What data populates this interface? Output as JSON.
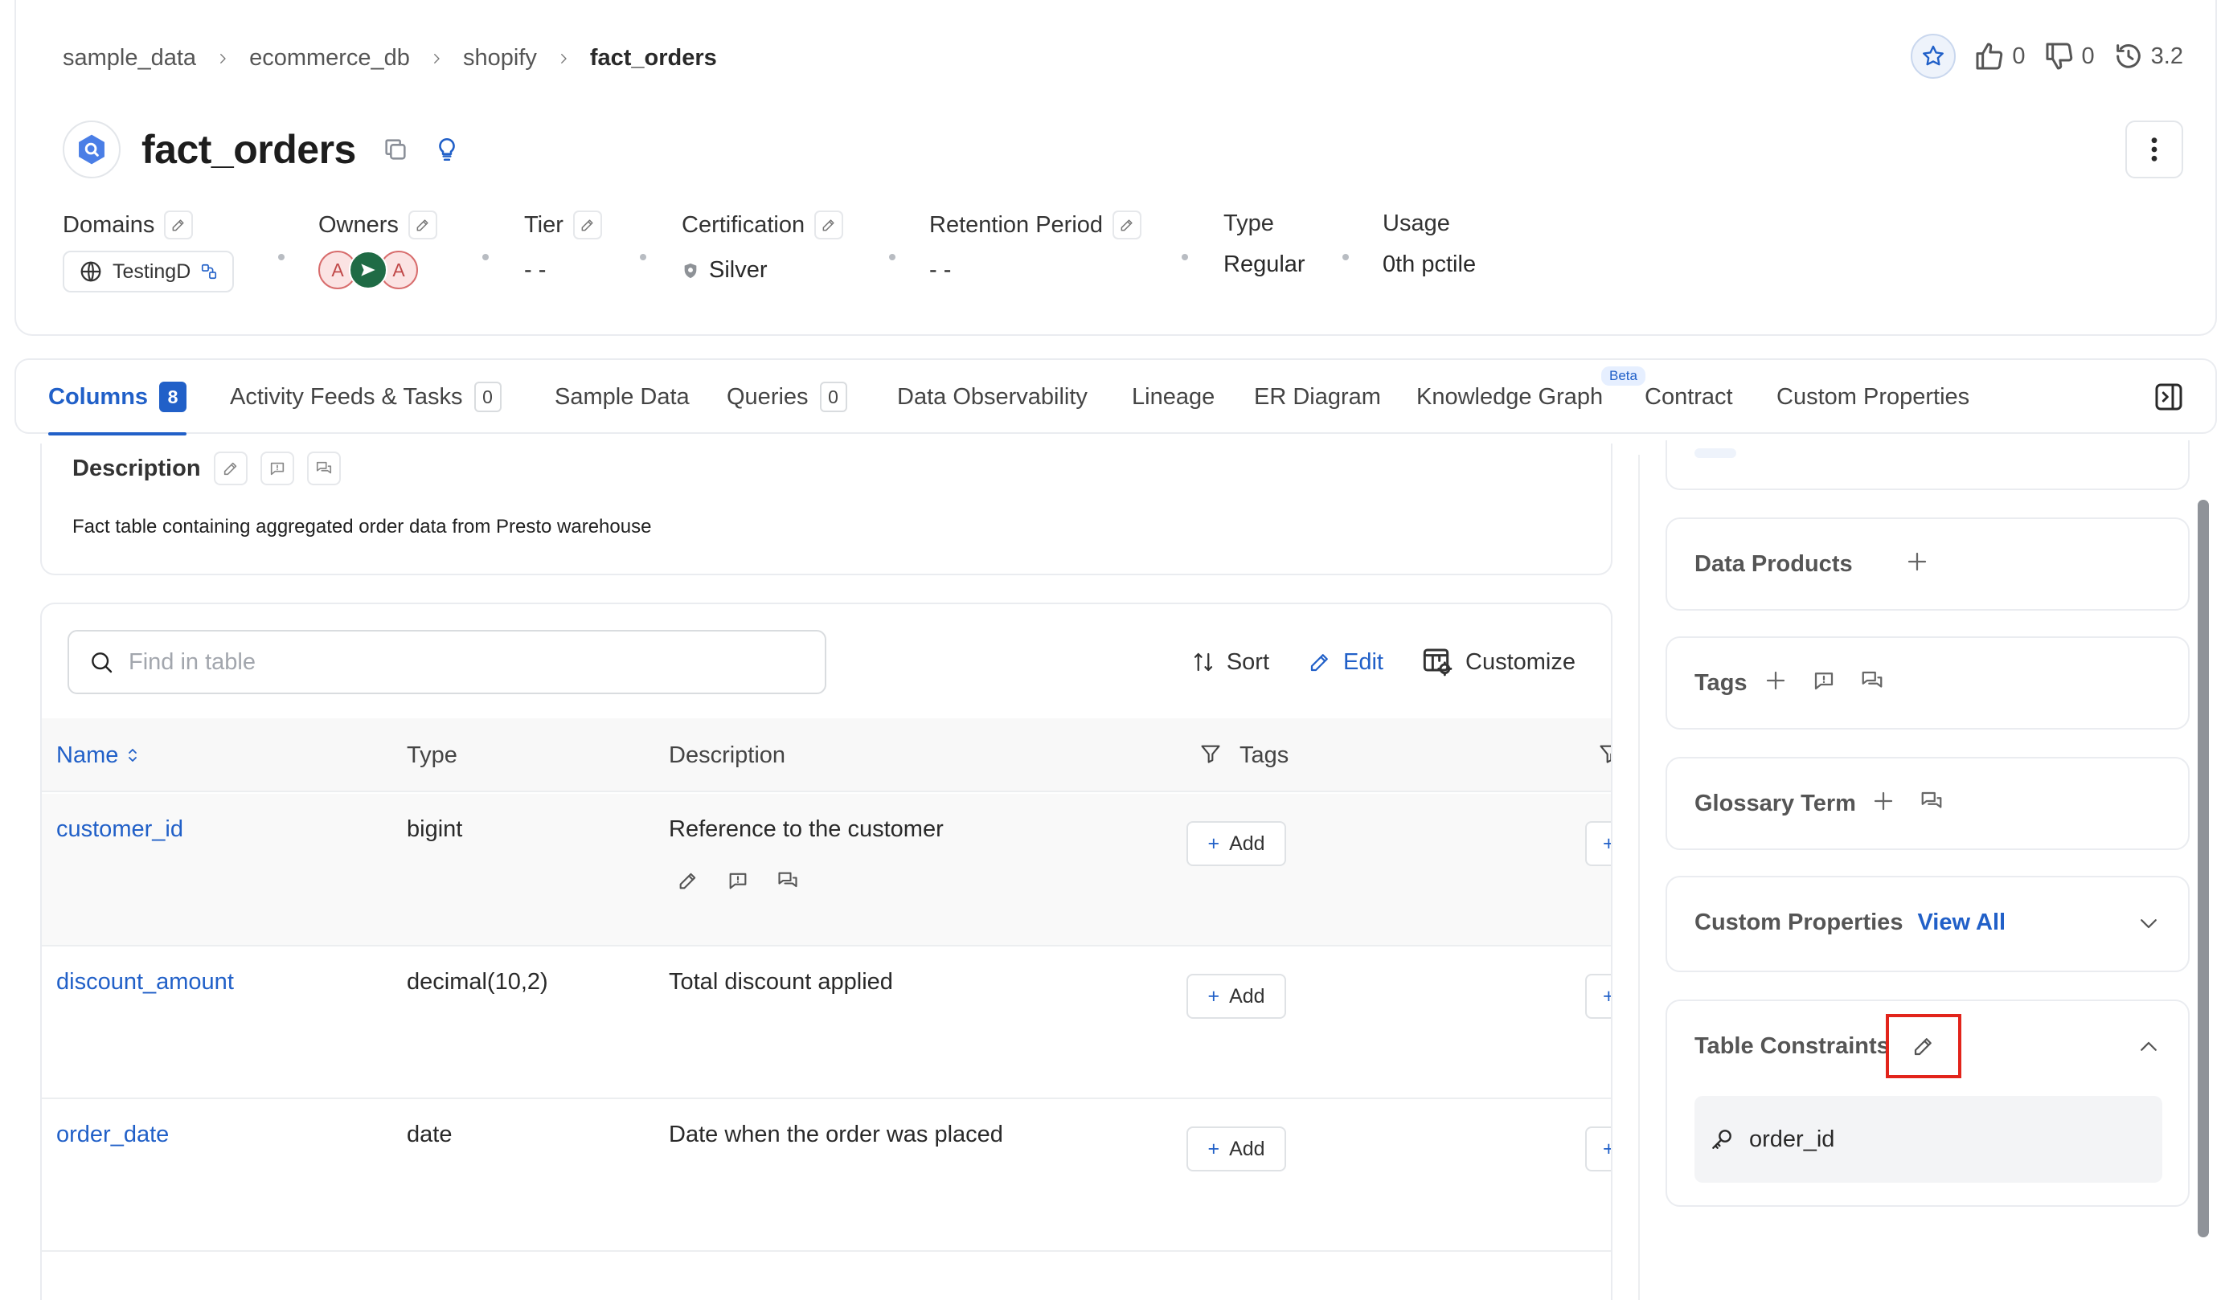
{
  "breadcrumb": [
    "sample_data",
    "ecommerce_db",
    "shopify",
    "fact_orders"
  ],
  "actions": {
    "upvotes": "0",
    "downvotes": "0",
    "version": "3.2"
  },
  "entity": {
    "name": "fact_orders"
  },
  "properties": {
    "domains_label": "Domains",
    "domain_value": "TestingD",
    "owners_label": "Owners",
    "owners": [
      "A",
      "A"
    ],
    "tier_label": "Tier",
    "tier_value": "- -",
    "certification_label": "Certification",
    "certification_value": "Silver",
    "retention_label": "Retention Period",
    "retention_value": "- -",
    "type_label": "Type",
    "type_value": "Regular",
    "usage_label": "Usage",
    "usage_value": "0th pctile"
  },
  "tabs": [
    {
      "label": "Columns",
      "count": "8"
    },
    {
      "label": "Activity Feeds & Tasks",
      "count": "0"
    },
    {
      "label": "Sample Data"
    },
    {
      "label": "Queries",
      "count": "0"
    },
    {
      "label": "Data Observability"
    },
    {
      "label": "Lineage"
    },
    {
      "label": "ER Diagram"
    },
    {
      "label": "Knowledge Graph",
      "badge": "Beta"
    },
    {
      "label": "Contract"
    },
    {
      "label": "Custom Properties"
    }
  ],
  "description": {
    "title": "Description",
    "text": "Fact table containing aggregated order data from Presto warehouse"
  },
  "table": {
    "search_placeholder": "Find in table",
    "sort_label": "Sort",
    "edit_label": "Edit",
    "customize_label": "Customize",
    "headers": {
      "name": "Name",
      "type": "Type",
      "description": "Description",
      "tags": "Tags"
    },
    "add_label": "Add",
    "rows": [
      {
        "name": "customer_id",
        "type": "bigint",
        "description": "Reference to the customer"
      },
      {
        "name": "discount_amount",
        "type": "decimal(10,2)",
        "description": "Total discount applied"
      },
      {
        "name": "order_date",
        "type": "date",
        "description": "Date when the order was placed"
      }
    ]
  },
  "right_panel": {
    "data_products": "Data Products",
    "tags": "Tags",
    "glossary_term": "Glossary Term",
    "custom_properties": "Custom Properties",
    "view_all": "View All",
    "table_constraints": "Table Constraints",
    "constraint_value": "order_id"
  },
  "colors": {
    "accent": "#2160c8",
    "highlight": "#e2241b"
  }
}
